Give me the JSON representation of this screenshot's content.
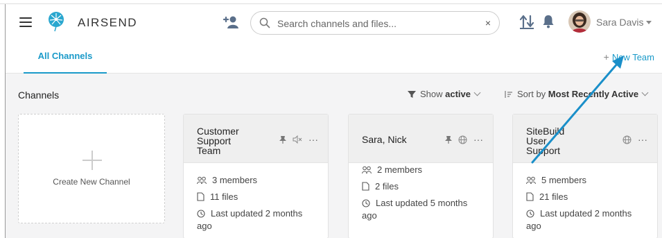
{
  "app": {
    "brand": "AIRSEND"
  },
  "search": {
    "placeholder": "Search channels and files...",
    "value": "",
    "clear_label": "×"
  },
  "user": {
    "name": "Sara Davis"
  },
  "tabs": {
    "all_channels": "All Channels",
    "new_team": "New Team",
    "new_team_plus": "+"
  },
  "toolbar": {
    "section_title": "Channels",
    "filter_prefix": "Show ",
    "filter_value": "active",
    "sort_prefix": "Sort by ",
    "sort_value": "Most Recently Active"
  },
  "create_channel": {
    "label": "Create New Channel"
  },
  "channels": [
    {
      "name_lines": [
        "Customer",
        "Support",
        "Team"
      ],
      "members": "3 members",
      "files": "11 files",
      "updated_line1": "Last updated 2 months",
      "updated_line2": "ago",
      "icons": [
        "pin-icon",
        "mute-icon",
        "more-icon"
      ]
    },
    {
      "name_lines": [
        "Sara, Nick"
      ],
      "members": "2 members",
      "files": "2 files",
      "updated_line1": "Last updated 5 months",
      "updated_line2": "ago",
      "icons": [
        "pin-icon",
        "globe-icon",
        "more-icon"
      ]
    },
    {
      "name_lines": [
        "SiteBuild",
        "User",
        "Support"
      ],
      "members": "5 members",
      "files": "21 files",
      "updated_line1": "Last updated 2 months",
      "updated_line2": "ago",
      "icons": [
        "globe-icon",
        "more-icon"
      ]
    }
  ],
  "colors": {
    "accent": "#1a9ac9",
    "annotation_arrow": "#1a8fc9",
    "content_bg": "#f4f4f5"
  }
}
